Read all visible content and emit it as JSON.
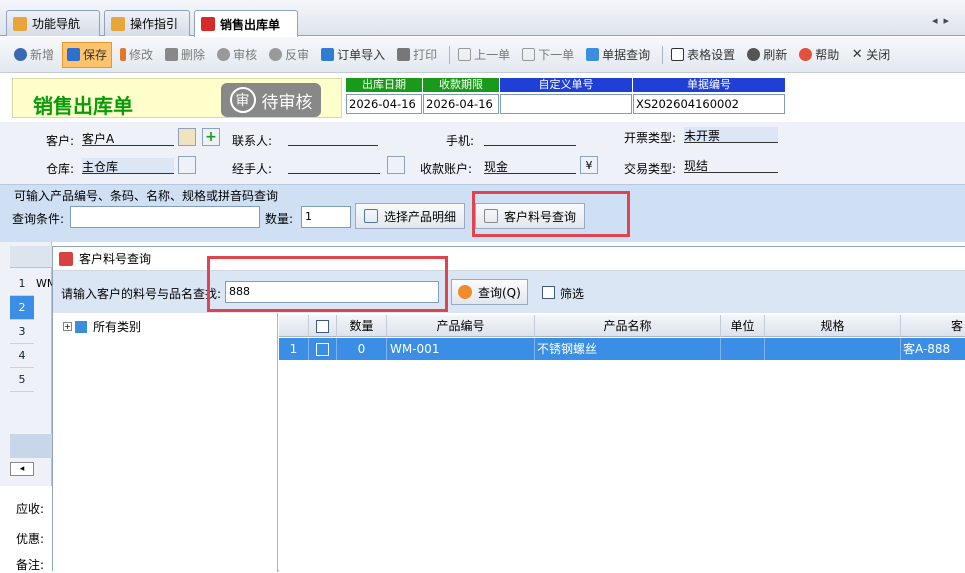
{
  "tabs": [
    {
      "label": "功能导航",
      "icon": "nav-icon"
    },
    {
      "label": "操作指引",
      "icon": "guide-icon"
    },
    {
      "label": "销售出库单",
      "icon": "outbound-icon"
    }
  ],
  "tabnav": {
    "left": "◂",
    "right": "▸"
  },
  "toolbar": {
    "new": "新增",
    "save": "保存",
    "edit": "修改",
    "delete": "删除",
    "audit": "审核",
    "unaudit": "反审",
    "order_import": "订单导入",
    "print": "打印",
    "prev": "上一单",
    "next": "下一单",
    "bill_query": "单据查询",
    "grid_settings": "表格设置",
    "refresh": "刷新",
    "help": "帮助",
    "close": "关闭"
  },
  "header": {
    "title": "销售出库单",
    "status_badge": "审",
    "status": "待审核",
    "fields": [
      {
        "caption": "出库日期",
        "value": "2026-04-16",
        "color": "#1a9a1a"
      },
      {
        "caption": "收款期限",
        "value": "2026-04-16",
        "color": "#1a9a1a"
      },
      {
        "caption": "自定义单号",
        "value": "",
        "color": "#1f3fd6"
      },
      {
        "caption": "单据编号",
        "value": "XS202604160002",
        "color": "#1f3fd6"
      }
    ]
  },
  "form": {
    "customer_label": "客户:",
    "customer": "客户A",
    "contact_label": "联系人:",
    "contact": "",
    "phone_label": "手机:",
    "phone": "",
    "invoice_type_label": "开票类型:",
    "invoice_type": "未开票",
    "warehouse_label": "仓库:",
    "warehouse": "主仓库",
    "handler_label": "经手人:",
    "handler": "",
    "account_label": "收款账户:",
    "account": "现金",
    "trade_type_label": "交易类型:",
    "trade_type": "现结",
    "currency_glyph": "¥"
  },
  "query": {
    "legend": "可输入产品编号、条码、名称、规格或拼音码查询",
    "condition_label": "查询条件:",
    "condition_value": "",
    "qty_label": "数量:",
    "qty_value": "1",
    "select_detail": "选择产品明细",
    "customer_code_query": "客户料号查询"
  },
  "left_rows": [
    "1",
    "2",
    "3",
    "4",
    "5"
  ],
  "left_row1_code": "WM",
  "bottom_labels": {
    "receive": "应收:",
    "discount": "优惠:",
    "remark": "备注:"
  },
  "dialog": {
    "title": "客户料号查询",
    "prompt": "请输入客户的料号与品名查找:",
    "search_value": "888",
    "query_button": "查询(Q)",
    "filter_label": "筛选",
    "tree_root": "所有类别",
    "columns": [
      "数量",
      "产品编号",
      "产品名称",
      "单位",
      "规格",
      "客"
    ],
    "rows": [
      {
        "index": "1",
        "qty": "0",
        "code": "WM-001",
        "name": "不锈钢螺丝",
        "unit": "",
        "spec": "",
        "customer_code": "客A-888"
      }
    ]
  }
}
